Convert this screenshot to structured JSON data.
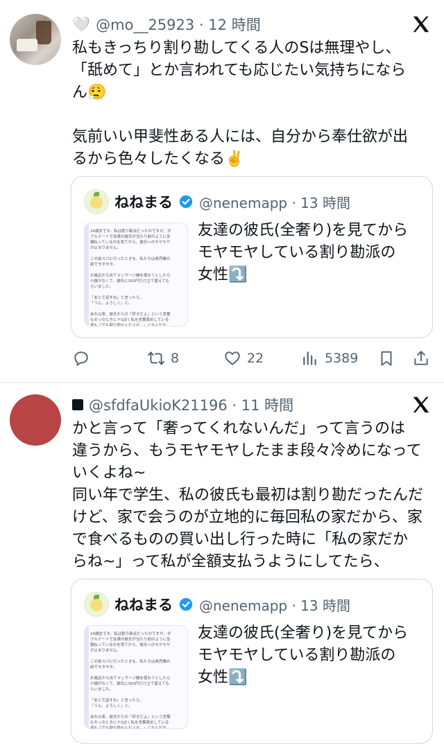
{
  "tweets": [
    {
      "handle_line": "@mo__25923 · 12 時間",
      "text_lines": [
        "私もきっちり割り勘してくる人のSは無理やし、",
        "「舐めて」とか言われても応じたい気持ちになら",
        "ん😮‍💨",
        "",
        "気前いい甲斐性ある人には、自分から奉仕欲が出",
        "るから色々したくなる✌️"
      ],
      "quote": {
        "name": "ねねまる",
        "handle_line": "@nenemapp · 13 時間",
        "text_lines": [
          "友達の彼氏(全奢り)を見てから",
          "モヤモヤしている割り勘派の",
          "女性⤵️"
        ],
        "thumb_text": "24歳女です。私は割り勘派だったのですが、ダ\nブルデートで友達の彼氏が当たり前のように全\n額払っているのを見てから、彼氏へのモヤモヤ\nが止まりません。\n\nこの前スパに行ったときも、私たちは券売機の\n前でモタモタ。\n\nお風呂から出てマッサージ機を使おうとしたら\n小銭がなくて、彼氏に300円だけ立て替えても\nらいました。\n\n「あとで返すね」と言ったら、\n「うん、よろしく」と。\n\nあれ以来、彼氏からの「好きだよ」という言葉\nもセッのときにドSぼく私を言葉責めしている\n姿も「でも割り勘なんだよな…」となんだか\nひややかな目で見てしまいます。"
      },
      "stats": {
        "retweets": "8",
        "likes": "22",
        "views": "5389"
      }
    },
    {
      "handle_line": "@sfdfaUkioK21196 · 11 時間",
      "text_lines": [
        "かと言って「奢ってくれないんだ」って言うのは",
        "違うから、もうモヤモヤしたまま段々冷めになって",
        "いくよね~",
        "同い年で学生、私の彼氏も最初は割り勘だったんだ",
        "けど、家で会うのが立地的に毎回私の家だから、家",
        "で食べるものの買い出し行った時に「私の家だか",
        "らね~」って私が全額支払うようにしてたら、"
      ],
      "quote": {
        "name": "ねねまる",
        "handle_line": "@nenemapp · 13 時間",
        "text_lines": [
          "友達の彼氏(全奢り)を見てから",
          "モヤモヤしている割り勘派の",
          "女性⤵️"
        ],
        "thumb_text": "24歳女です。私は割り勘派だったのですが、ダ\nブルデートで友達の彼氏が当たり前のように全\n額払っているのを見てから、彼氏へのモヤモヤ\nが止まりません。\n\nこの前スパに行ったときも、私たちは券売機の\n前でモタモタ。\n\nお風呂から出てマッサージ機を使おうとしたら\n小銭がなくて、彼氏に300円だけ立て替えても\nらいました。\n\n「あとで返すね」と言ったら、\n「うん、よろしく」と。\n\nあれ以来、彼氏からの「好きだよ」という言葉\nもセッのときにドSぼく私を言葉責めしている\n姿も「でも割り勘なんだよな…」となんだか\nひややかな目で見てしまいます。"
      }
    }
  ],
  "icons": {
    "heart_badge": "heart-outline-icon",
    "square_badge": "black-square-icon",
    "x_logo": "x-logo-icon",
    "verified": "verified-badge-icon",
    "reply": "reply-icon",
    "retweet": "retweet-icon",
    "like": "heart-icon",
    "views": "views-icon",
    "bookmark": "bookmark-icon",
    "share": "share-icon"
  },
  "colors": {
    "secondary_text": "#536471",
    "verified": "#1d9bf0",
    "border": "#cfd9de"
  }
}
